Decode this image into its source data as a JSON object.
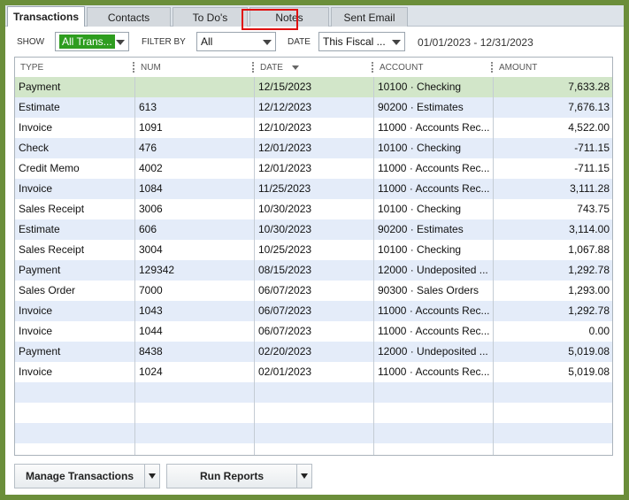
{
  "tabs": [
    {
      "label": "Transactions",
      "active": true
    },
    {
      "label": "Contacts",
      "active": false
    },
    {
      "label": "To Do's",
      "active": false
    },
    {
      "label": "Notes",
      "active": false
    },
    {
      "label": "Sent Email",
      "active": false
    }
  ],
  "filters": {
    "show_label": "SHOW",
    "show_value": "All Trans...",
    "filter_by_label": "FILTER BY",
    "filter_by_value": "All",
    "date_label": "DATE",
    "date_value": "This Fiscal ...",
    "date_range": "01/01/2023 - 12/31/2023"
  },
  "columns": {
    "type": "TYPE",
    "num": "NUM",
    "date": "DATE",
    "account": "ACCOUNT",
    "amount": "AMOUNT"
  },
  "rows": [
    {
      "type": "Payment",
      "num": "",
      "date": "12/15/2023",
      "account": "10100 · Checking",
      "amount": "7,633.28",
      "selected": true
    },
    {
      "type": "Estimate",
      "num": "613",
      "date": "12/12/2023",
      "account": "90200 · Estimates",
      "amount": "7,676.13"
    },
    {
      "type": "Invoice",
      "num": "1091",
      "date": "12/10/2023",
      "account": "11000 · Accounts Rec...",
      "amount": "4,522.00"
    },
    {
      "type": "Check",
      "num": "476",
      "date": "12/01/2023",
      "account": "10100 · Checking",
      "amount": "-711.15"
    },
    {
      "type": "Credit Memo",
      "num": "4002",
      "date": "12/01/2023",
      "account": "11000 · Accounts Rec...",
      "amount": "-711.15"
    },
    {
      "type": "Invoice",
      "num": "1084",
      "date": "11/25/2023",
      "account": "11000 · Accounts Rec...",
      "amount": "3,111.28"
    },
    {
      "type": "Sales Receipt",
      "num": "3006",
      "date": "10/30/2023",
      "account": "10100 · Checking",
      "amount": "743.75"
    },
    {
      "type": "Estimate",
      "num": "606",
      "date": "10/30/2023",
      "account": "90200 · Estimates",
      "amount": "3,114.00"
    },
    {
      "type": "Sales Receipt",
      "num": "3004",
      "date": "10/25/2023",
      "account": "10100 · Checking",
      "amount": "1,067.88"
    },
    {
      "type": "Payment",
      "num": "129342",
      "date": "08/15/2023",
      "account": "12000 · Undeposited ...",
      "amount": "1,292.78"
    },
    {
      "type": "Sales Order",
      "num": "7000",
      "date": "06/07/2023",
      "account": "90300 · Sales Orders",
      "amount": "1,293.00"
    },
    {
      "type": "Invoice",
      "num": "1043",
      "date": "06/07/2023",
      "account": "11000 · Accounts Rec...",
      "amount": "1,292.78"
    },
    {
      "type": "Invoice",
      "num": "1044",
      "date": "06/07/2023",
      "account": "11000 · Accounts Rec...",
      "amount": "0.00"
    },
    {
      "type": "Payment",
      "num": "8438",
      "date": "02/20/2023",
      "account": "12000 · Undeposited ...",
      "amount": "5,019.08"
    },
    {
      "type": "Invoice",
      "num": "1024",
      "date": "02/01/2023",
      "account": "11000 · Accounts Rec...",
      "amount": "5,019.08"
    }
  ],
  "empty_rows": 4,
  "buttons": {
    "manage": "Manage Transactions",
    "reports": "Run Reports"
  },
  "colors": {
    "frame": "#6b8e3a",
    "selected_row": "#d2e6c9",
    "alt_row": "#e4ecf9",
    "show_filter": "#2e9d1f",
    "sort_highlight": "#e01010"
  }
}
